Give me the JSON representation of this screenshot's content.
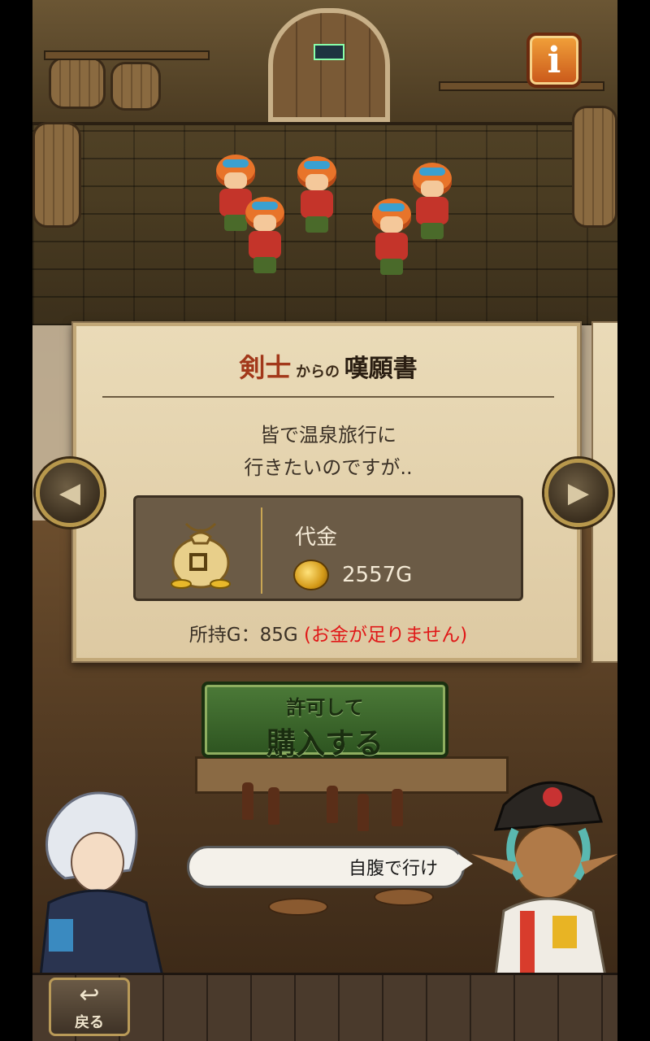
{
  "info_button": {
    "label": "i"
  },
  "letter": {
    "title_sender": "剣士",
    "title_from": "からの",
    "title_petition": "嘆願書",
    "message_line1": "皆で温泉旅行に",
    "message_line2": "行きたいのですが..",
    "price_label": "代金",
    "price_value": "2557G",
    "owned_label": "所持G：85G",
    "owned_warning": "(お金が足りません)"
  },
  "buy_button": {
    "line1": "許可して",
    "line2": "購入する"
  },
  "speech_bubble": {
    "text": "自腹で行け"
  },
  "back_button": {
    "label": "戻る"
  },
  "nav": {
    "prev_icon": "◀",
    "next_icon": "▶"
  },
  "colors": {
    "warning": "#e01818",
    "title_accent": "#a2381a",
    "button_green": "#4c7a38"
  }
}
